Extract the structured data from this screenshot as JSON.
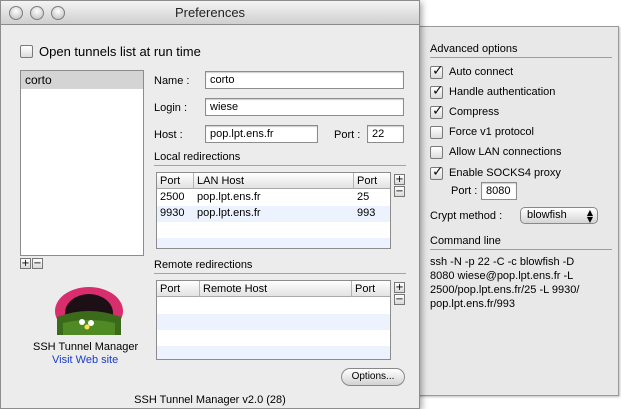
{
  "window": {
    "title": "Preferences"
  },
  "main": {
    "open_tunnels_label": "Open tunnels list at run time",
    "tunnels": [
      "corto"
    ],
    "name_label": "Name :",
    "name_value": "corto",
    "login_label": "Login :",
    "login_value": "wiese",
    "host_label": "Host :",
    "host_value": "pop.lpt.ens.fr",
    "port_label": "Port :",
    "port_value": "22",
    "local_redirections_title": "Local redirections",
    "local_table": {
      "headers": [
        "Port",
        "LAN Host",
        "Port"
      ],
      "rows": [
        [
          "2500",
          "pop.lpt.ens.fr",
          "25"
        ],
        [
          "9930",
          "pop.lpt.ens.fr",
          "993"
        ]
      ]
    },
    "remote_redirections_title": "Remote redirections",
    "remote_table": {
      "headers": [
        "Port",
        "Remote Host",
        "Port"
      ]
    },
    "add_symbol": "+",
    "remove_symbol": "−",
    "app_name": "SSH Tunnel Manager",
    "website_link": "Visit Web site",
    "options_button": "Options...",
    "version": "SSH Tunnel Manager v2.0 (28)"
  },
  "drawer": {
    "advanced_title": "Advanced options",
    "options": [
      {
        "label": "Auto connect",
        "checked": true
      },
      {
        "label": "Handle authentication",
        "checked": true
      },
      {
        "label": "Compress",
        "checked": true
      },
      {
        "label": "Force v1 protocol",
        "checked": false
      },
      {
        "label": "Allow LAN connections",
        "checked": false
      },
      {
        "label": "Enable SOCKS4 proxy",
        "checked": true
      }
    ],
    "socks_port_label": "Port :",
    "socks_port_value": "8080",
    "crypt_label": "Crypt method :",
    "crypt_value": "blowfish",
    "command_title": "Command line",
    "command_lines": [
      "ssh -N -p 22 -C -c blowfish -D",
      "8080 wiese@pop.lpt.ens.fr -L",
      "2500/pop.lpt.ens.fr/25 -L 9930/",
      "pop.lpt.ens.fr/993"
    ]
  },
  "colors": {
    "link": "#1a3cc8",
    "window_bg": "#ececec",
    "drawer_bg": "#e8e8e8",
    "selection": "#d4d4d4"
  }
}
